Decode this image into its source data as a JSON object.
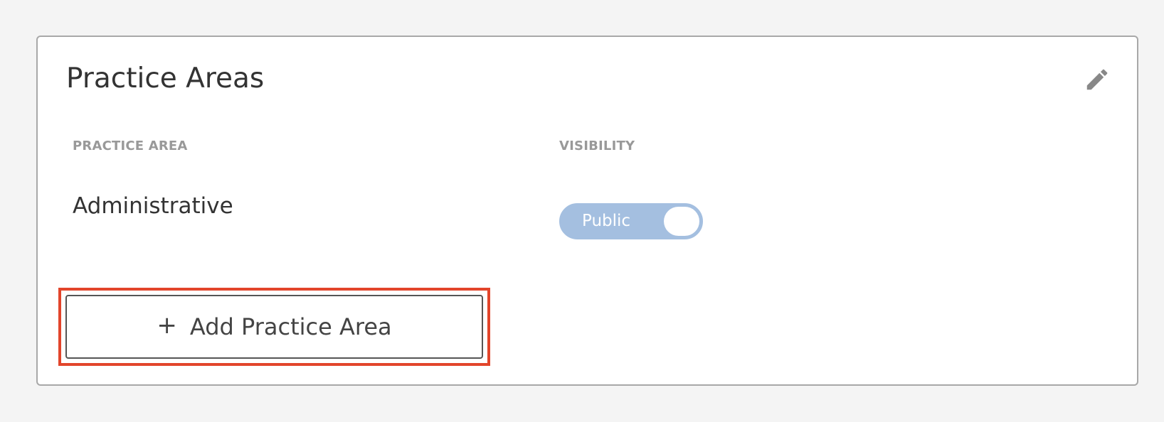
{
  "card": {
    "title": "Practice Areas",
    "edit_icon": "pencil-icon"
  },
  "table": {
    "headers": [
      "PRACTICE AREA",
      "VISIBILITY"
    ],
    "rows": [
      {
        "practice_area": "Administrative",
        "visibility": "Public",
        "toggle_on": true
      }
    ]
  },
  "actions": {
    "add_icon": "plus-icon",
    "plus_glyph": "+",
    "add_label": "Add Practice Area"
  },
  "colors": {
    "toggle_fill": "#a4bfe0",
    "highlight": "#e2452b",
    "header_text": "#999999"
  }
}
